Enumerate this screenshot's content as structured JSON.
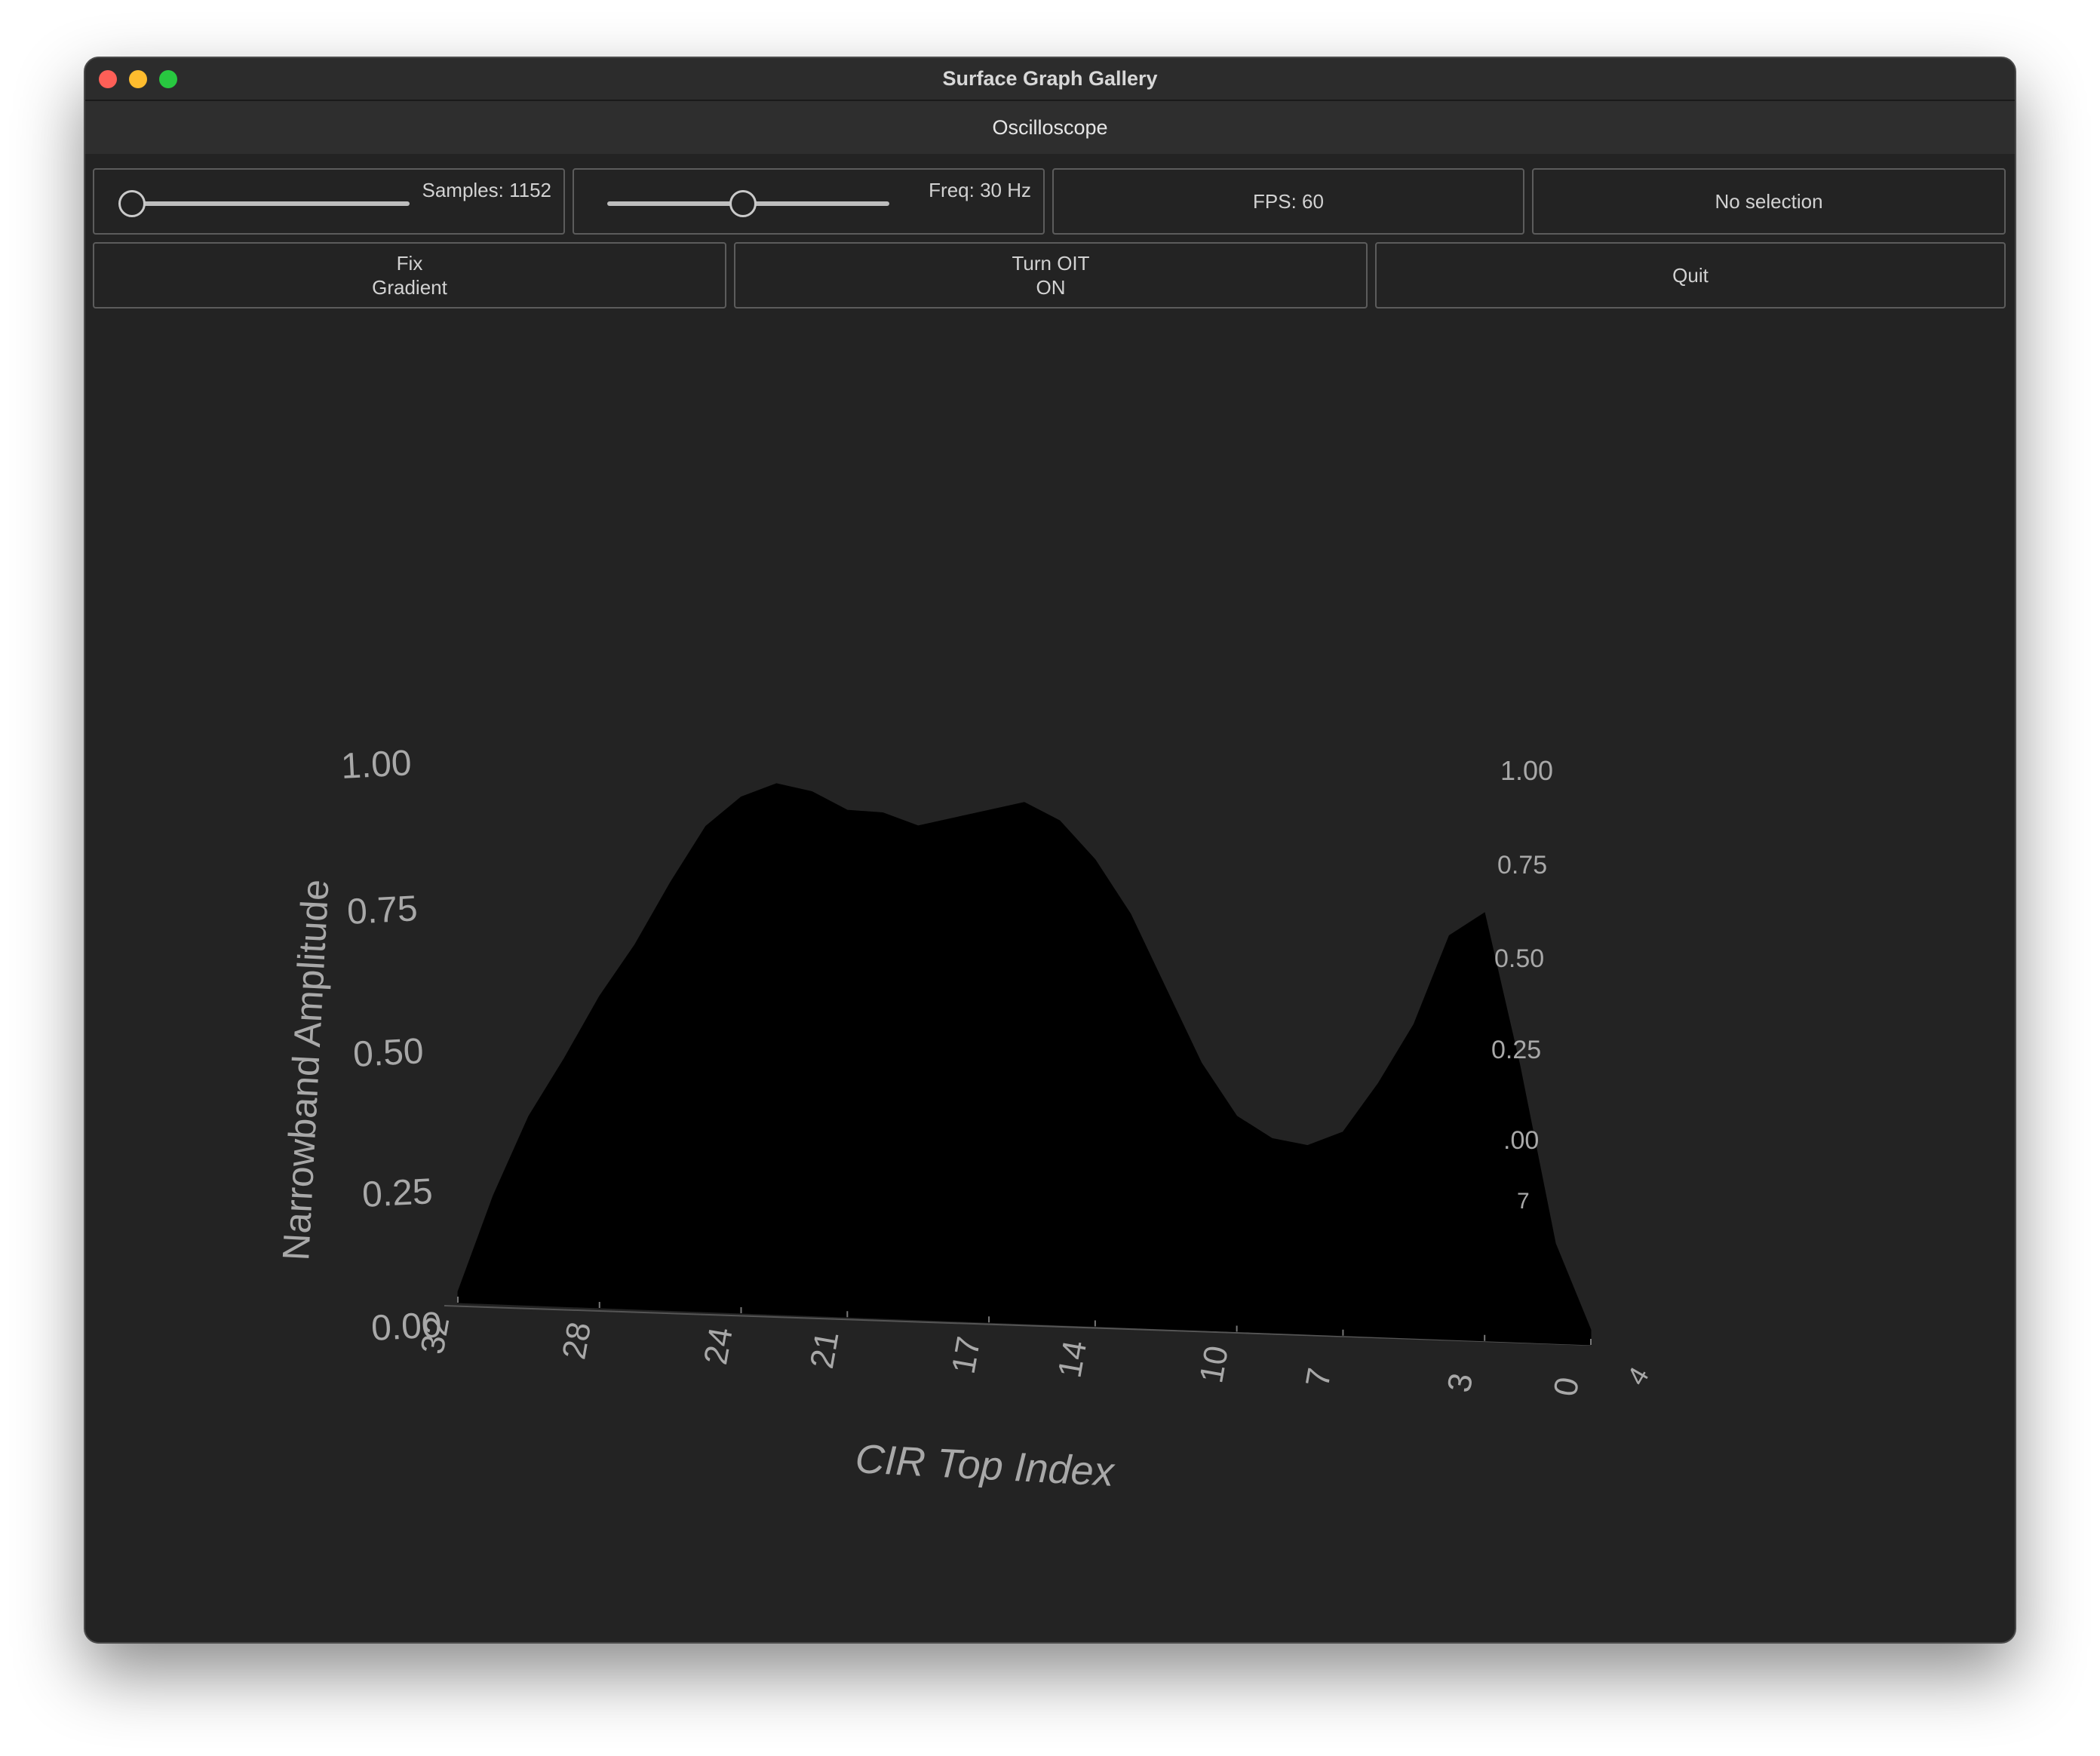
{
  "window": {
    "title": "Surface Graph Gallery"
  },
  "tabs": {
    "active": "Oscilloscope"
  },
  "controls": {
    "samples_label": "Samples: 1152",
    "samples_level": 0.0,
    "freq_label": "Freq: 30 Hz",
    "freq_level": 0.48,
    "fps_label": "FPS: 60",
    "selection_label": "No selection",
    "gradient_button": [
      "Fix",
      "Gradient"
    ],
    "oit_button": [
      "Turn OIT",
      "ON"
    ],
    "quit_button": "Quit"
  },
  "chart_data": {
    "type": "area",
    "ylabel": "Narrowband Amplitude",
    "xlabel": "CIR Top Index",
    "ylim": [
      0.0,
      1.0
    ],
    "y_ticks": [
      "0.00",
      "0.25",
      "0.50",
      "0.75",
      "1.00"
    ],
    "x_ticks": [
      "32",
      "28",
      "24",
      "21",
      "17",
      "14",
      "10",
      "7",
      "3",
      "0"
    ],
    "z_ticks_visible": [
      "1.00",
      "0.75",
      "0.50",
      "0.25",
      ".00",
      "7",
      "4"
    ],
    "fill_color": "#000000",
    "x": [
      32,
      31,
      30,
      29,
      28,
      27,
      26,
      25,
      24,
      23,
      22,
      21,
      20,
      19,
      18,
      17,
      16,
      15,
      14,
      13,
      12,
      11,
      10,
      9,
      8,
      7,
      6,
      5,
      4,
      3,
      2,
      1,
      0
    ],
    "y": [
      0.02,
      0.2,
      0.35,
      0.46,
      0.58,
      0.68,
      0.8,
      0.91,
      0.97,
      1.0,
      0.99,
      0.96,
      0.96,
      0.94,
      0.96,
      0.98,
      1.0,
      0.97,
      0.9,
      0.8,
      0.66,
      0.52,
      0.42,
      0.38,
      0.37,
      0.4,
      0.5,
      0.62,
      0.8,
      0.85,
      0.55,
      0.2,
      0.03
    ],
    "background": "#232323",
    "text_color": "#a8a8a8"
  }
}
